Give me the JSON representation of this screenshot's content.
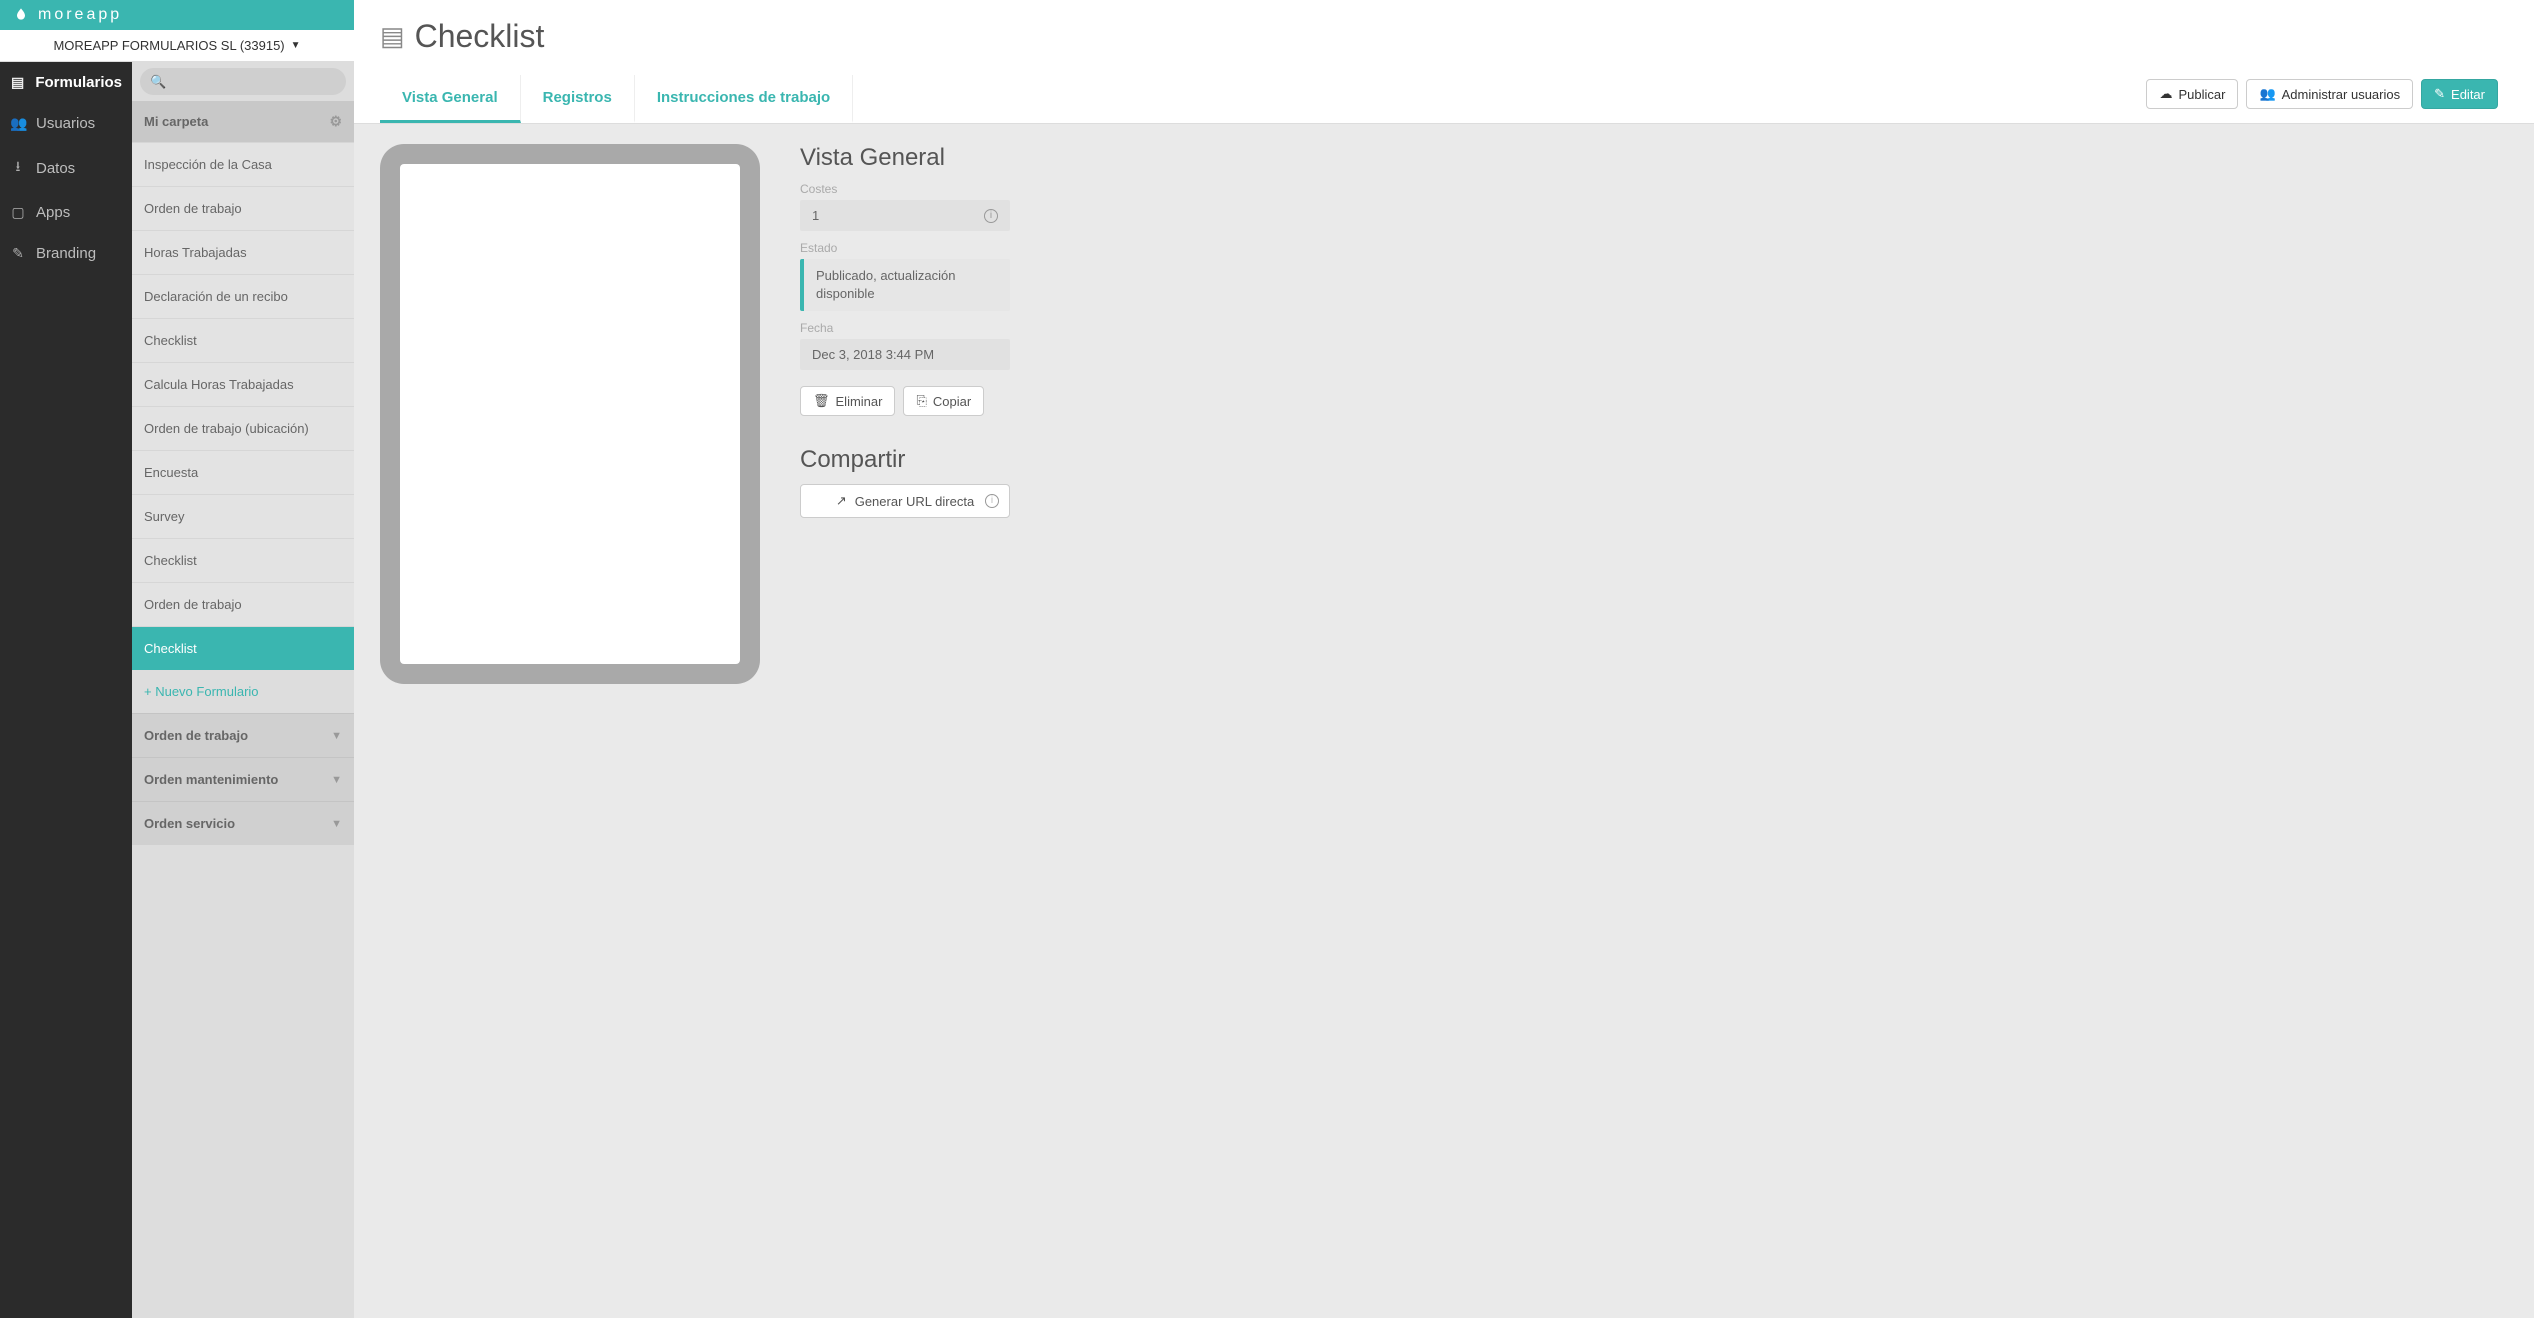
{
  "brand": {
    "name": "moreapp"
  },
  "account": {
    "label": "MOREAPP FORMULARIOS SL (33915)"
  },
  "nav": [
    {
      "label": "Formularios",
      "icon": "form-icon",
      "active": true
    },
    {
      "label": "Usuarios",
      "icon": "users-icon",
      "active": false
    },
    {
      "label": "Datos",
      "icon": "download-icon",
      "active": false
    },
    {
      "label": "Apps",
      "icon": "tablet-icon",
      "active": false
    },
    {
      "label": "Branding",
      "icon": "brush-icon",
      "active": false
    }
  ],
  "search": {
    "placeholder": ""
  },
  "folder": {
    "name": "Mi carpeta",
    "forms": [
      {
        "label": "Inspección de la Casa",
        "selected": false
      },
      {
        "label": "Orden de trabajo",
        "selected": false
      },
      {
        "label": "Horas Trabajadas",
        "selected": false
      },
      {
        "label": "Declaración de un recibo",
        "selected": false
      },
      {
        "label": "Checklist",
        "selected": false
      },
      {
        "label": "Calcula Horas Trabajadas",
        "selected": false
      },
      {
        "label": "Orden de trabajo (ubicación)",
        "selected": false
      },
      {
        "label": "Encuesta",
        "selected": false
      },
      {
        "label": "Survey",
        "selected": false
      },
      {
        "label": "Checklist",
        "selected": false
      },
      {
        "label": "Orden de trabajo",
        "selected": false
      },
      {
        "label": "Checklist",
        "selected": true
      }
    ],
    "new_form_label": "+ Nuevo Formulario"
  },
  "collapsed_folders": [
    {
      "label": "Orden de trabajo"
    },
    {
      "label": "Orden mantenimiento"
    },
    {
      "label": "Orden servicio"
    }
  ],
  "page": {
    "title": "Checklist",
    "tabs": [
      {
        "label": "Vista General",
        "active": true
      },
      {
        "label": "Registros",
        "active": false
      },
      {
        "label": "Instrucciones de trabajo",
        "active": false
      }
    ],
    "actions": {
      "publish": "Publicar",
      "manage_users": "Administrar usuarios",
      "edit": "Editar"
    }
  },
  "overview": {
    "heading": "Vista General",
    "costs_label": "Costes",
    "costs_value": "1",
    "state_label": "Estado",
    "state_value": "Publicado, actualización disponible",
    "date_label": "Fecha",
    "date_value": "Dec 3, 2018 3:44 PM",
    "delete_label": "Eliminar",
    "copy_label": "Copiar"
  },
  "share": {
    "heading": "Compartir",
    "generate_label": "Generar URL directa"
  }
}
